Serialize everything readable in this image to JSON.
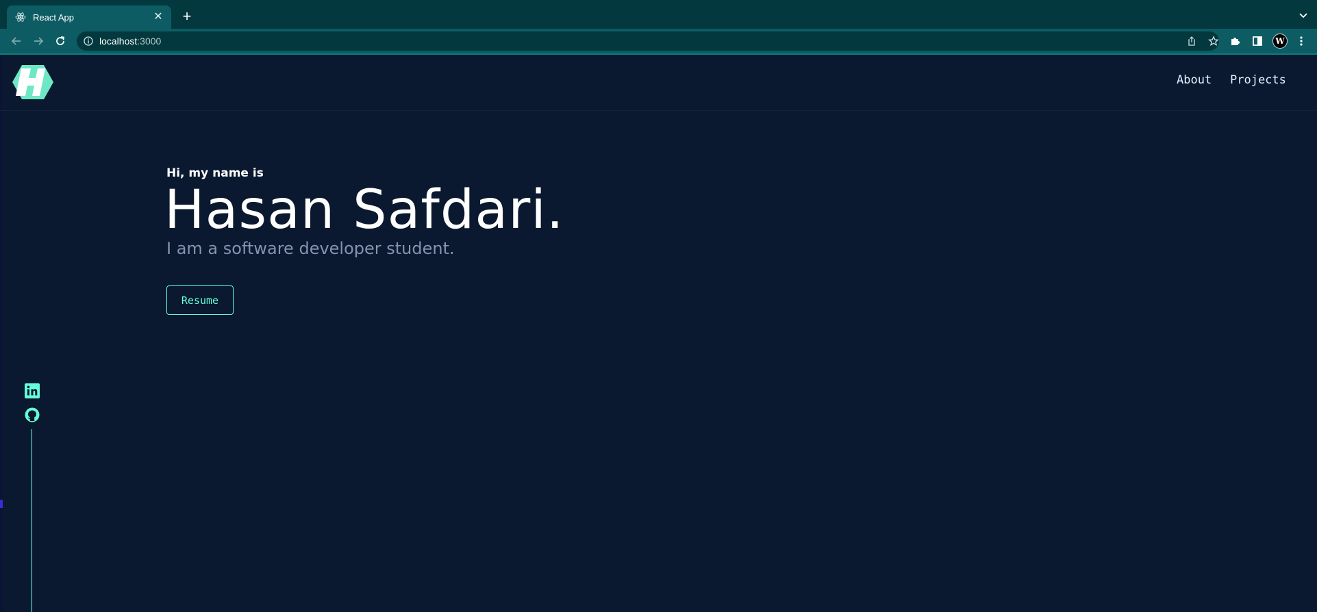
{
  "browser": {
    "tab": {
      "title": "React App",
      "favicon": "react-atom-icon"
    },
    "url_host": "localhost",
    "url_port": ":3000",
    "profile_initial": "W",
    "colors": {
      "tabbar": "#03383f",
      "toolbar": "#0d5c63",
      "omnibox": "#03383f"
    }
  },
  "site": {
    "logo": "hs-hexagon-logo",
    "nav": [
      {
        "label": "About"
      },
      {
        "label": "Projects"
      }
    ],
    "hero": {
      "greeting": "Hi, my name is",
      "name": "Hasan Safdari.",
      "tagline": "I am a software developer student.",
      "button_label": "Resume"
    },
    "social": [
      "linkedin-icon",
      "github-icon"
    ],
    "colors": {
      "background": "#0a192f",
      "accent": "#64ffda",
      "text": "#ffffff",
      "muted": "#8892b0"
    }
  }
}
